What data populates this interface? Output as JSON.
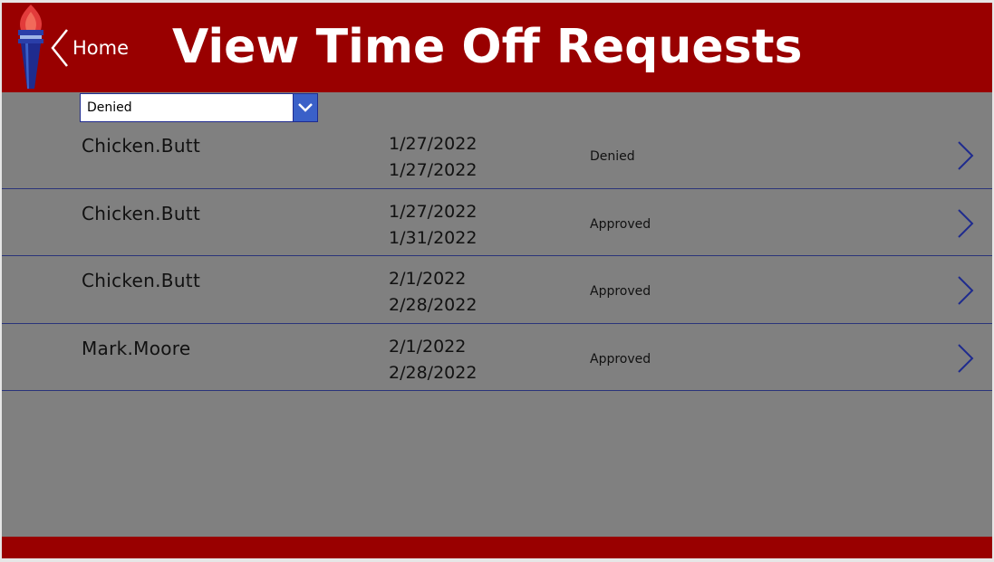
{
  "header": {
    "title": "View Time Off Requests",
    "back_label": "Home",
    "background_color": "#990000",
    "logo_icon": "torch-icon"
  },
  "filter": {
    "selected": "Denied",
    "icon": "chevron-down-icon"
  },
  "requests": [
    {
      "name": "Chicken.Butt",
      "start": "1/27/2022",
      "end": "1/27/2022",
      "status": "Denied"
    },
    {
      "name": "Chicken.Butt",
      "start": "1/27/2022",
      "end": "1/31/2022",
      "status": "Approved"
    },
    {
      "name": "Chicken.Butt",
      "start": "2/1/2022",
      "end": "2/28/2022",
      "status": "Approved"
    },
    {
      "name": "Mark.Moore",
      "start": "2/1/2022",
      "end": "2/28/2022",
      "status": "Approved"
    }
  ],
  "colors": {
    "accent_red": "#990000",
    "canvas_gray": "#808080",
    "navy": "#1f2b8e",
    "dropdown_blue": "#3a60c8"
  }
}
